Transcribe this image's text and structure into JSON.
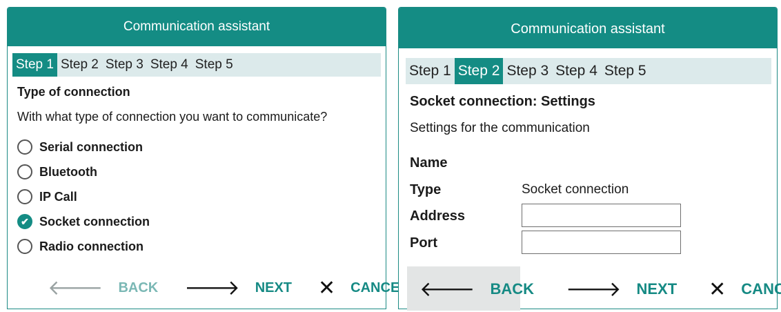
{
  "panel1": {
    "title": "Communication assistant",
    "steps": [
      "Step 1",
      "Step 2",
      "Step 3",
      "Step 4",
      "Step 5"
    ],
    "active_step": "Step 1",
    "heading": "Type of connection",
    "question": "With what type of connection you want to communicate?",
    "options": [
      {
        "label": "Serial connection",
        "checked": false
      },
      {
        "label": "Bluetooth",
        "checked": false
      },
      {
        "label": "IP Call",
        "checked": false
      },
      {
        "label": "Socket connection",
        "checked": true
      },
      {
        "label": "Radio connection",
        "checked": false
      }
    ],
    "buttons": {
      "back": "BACK",
      "next": "NEXT",
      "cancel": "CANCEL"
    }
  },
  "panel2": {
    "title": "Communication assistant",
    "steps": [
      "Step 1",
      "Step 2",
      "Step 3",
      "Step 4",
      "Step 5"
    ],
    "active_step": "Step 2",
    "heading": "Socket connection: Settings",
    "subtitle": "Settings for the communication",
    "fields": {
      "name_label": "Name",
      "type_label": "Type",
      "type_value": "Socket connection",
      "address_label": "Address",
      "address_value": "",
      "port_label": "Port",
      "port_value": ""
    },
    "buttons": {
      "back": "BACK",
      "next": "NEXT",
      "cancel": "CANCEL"
    }
  },
  "colors": {
    "accent": "#148c84",
    "steps_bg": "#dceaeb",
    "hover_bg": "#e3e5e5"
  },
  "icons": {
    "back": "arrow-left-icon",
    "next": "arrow-right-icon",
    "cancel": "close-icon",
    "checked": "checkmark-icon"
  }
}
